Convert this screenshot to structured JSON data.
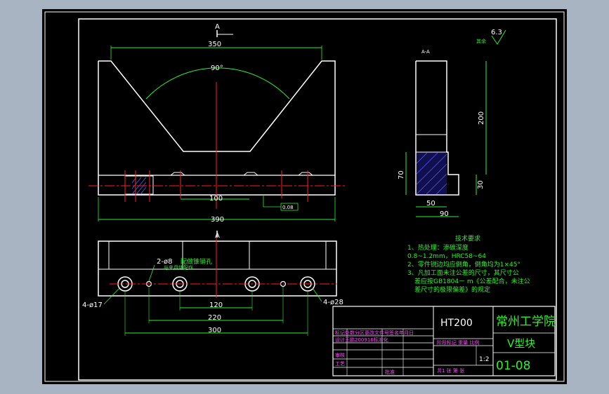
{
  "views": {
    "front_section_label": "A",
    "side_view_label": "A-A",
    "surface_finish": "6.3",
    "surface_finish_note": "其余",
    "angle": "90°"
  },
  "dimensions": {
    "top_width": "350",
    "bottom_width": "390",
    "slot_width": "100",
    "height": "200",
    "base_height": "70",
    "slot_depth": "30",
    "slot_width_side": "50",
    "side_width": "90",
    "flatness": "0.08",
    "hole_small": "4-ø17",
    "hole_large": "4-ø28",
    "pin_holes": "2-ø8",
    "pin_note": "配做锥销孔",
    "pin_note2": "与夹具体配作",
    "spacing_120": "120",
    "spacing_220": "220",
    "spacing_300": "300"
  },
  "tech_requirements": {
    "title": "技术要求",
    "line1": "1、热处理：渗碳深度",
    "line2": "0.8~1.2mm，HRC58~64",
    "line3": "2、零件锐边均应倒角，倒角均为1×45°",
    "line4": "3、凡加工面未注公差的尺寸，其尺寸公",
    "line5": "差应按GB1804－ m《公差配合，未注公",
    "line6": "差尺寸的极限偏差》的规定"
  },
  "title_block": {
    "material": "HT200",
    "school": "常州工学院",
    "part_name": "V型块",
    "drawing_no": "01-08",
    "scale": "1:2",
    "row_header": "标记处数分区更改文件号签名年月日",
    "designer_row": "设计王鹏200916标准化",
    "stage_header": "阶段标记 重量 比例",
    "sheet_info": "共1 张 第 张",
    "checker": "审核",
    "process": "工艺",
    "approve": "批准"
  }
}
